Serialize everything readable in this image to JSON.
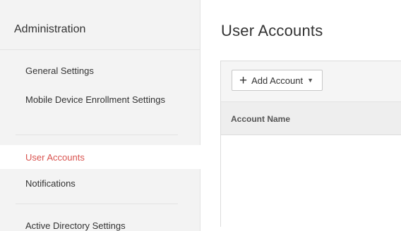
{
  "sidebar": {
    "title": "Administration",
    "items": [
      {
        "label": "General Settings"
      },
      {
        "label": "Mobile Device Enrollment Settings"
      },
      {
        "label": "User Accounts",
        "active": true
      },
      {
        "label": "Notifications"
      },
      {
        "label": "Active Directory Settings"
      }
    ]
  },
  "main": {
    "title": "User Accounts",
    "toolbar": {
      "add_button_label": "Add Account",
      "add_icon": "plus-icon",
      "dropdown_icon": "caret-down-icon"
    },
    "table": {
      "columns": [
        "Account Name"
      ],
      "rows": []
    }
  },
  "colors": {
    "active_nav": "#d9534f",
    "sidebar_bg": "#f3f3f3",
    "toolbar_bg": "#f5f5f5",
    "table_header_bg": "#eeeeee"
  }
}
